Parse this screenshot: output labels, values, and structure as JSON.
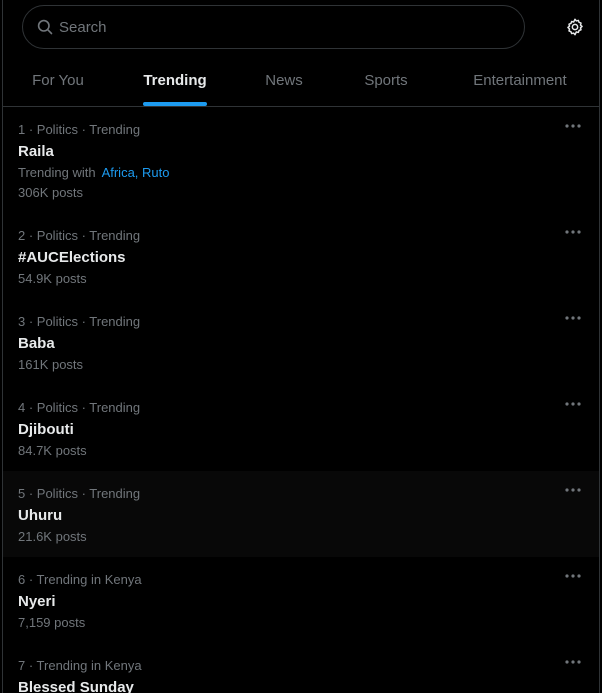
{
  "search": {
    "placeholder": "Search"
  },
  "tabs": [
    {
      "label": "For You",
      "active": false
    },
    {
      "label": "Trending",
      "active": true
    },
    {
      "label": "News",
      "active": false
    },
    {
      "label": "Sports",
      "active": false
    },
    {
      "label": "Entertainment",
      "active": false
    }
  ],
  "trends": [
    {
      "meta": "1 · Politics · Trending",
      "name": "Raila",
      "trending_with_label": "Trending with",
      "trending_with": "Africa, Ruto",
      "posts": "306K posts"
    },
    {
      "meta": "2 · Politics · Trending",
      "name": "#AUCElections",
      "posts": "54.9K posts"
    },
    {
      "meta": "3 · Politics · Trending",
      "name": "Baba",
      "posts": "161K posts"
    },
    {
      "meta": "4 · Politics · Trending",
      "name": "Djibouti",
      "posts": "84.7K posts"
    },
    {
      "meta": "5 · Politics · Trending",
      "name": "Uhuru",
      "posts": "21.6K posts"
    },
    {
      "meta": "6 · Trending in Kenya",
      "name": "Nyeri",
      "posts": "7,159 posts"
    },
    {
      "meta": "7 · Trending in Kenya",
      "name": "Blessed Sunday"
    }
  ],
  "icons": {
    "search": "search-icon",
    "settings": "gear-icon",
    "more": "more-icon"
  },
  "colors": {
    "background": "#000000",
    "accent": "#1d9bf0",
    "text_primary": "#e7e9ea",
    "text_secondary": "#71767b",
    "border": "#2f3336"
  }
}
